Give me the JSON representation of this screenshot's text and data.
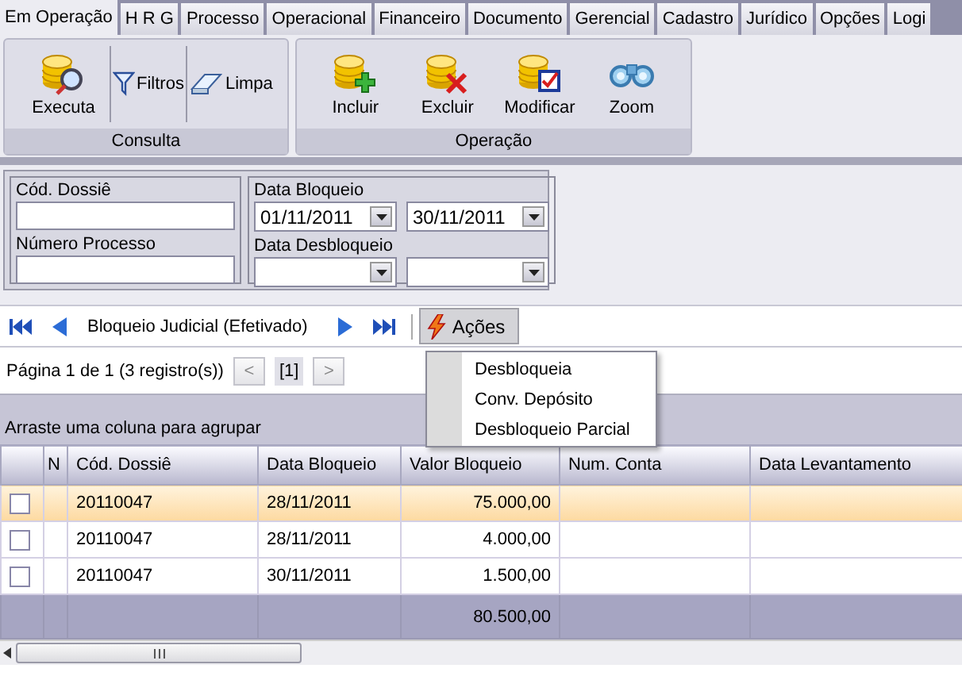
{
  "tabs": [
    {
      "label": "Em Operação",
      "selected": true
    },
    {
      "label": "H R G",
      "selected": false
    },
    {
      "label": "Processo",
      "selected": false
    },
    {
      "label": "Operacional",
      "selected": false
    },
    {
      "label": "Financeiro",
      "selected": false
    },
    {
      "label": "Documento",
      "selected": false
    },
    {
      "label": "Gerencial",
      "selected": false
    },
    {
      "label": "Cadastro",
      "selected": false
    },
    {
      "label": "Jurídico",
      "selected": false
    },
    {
      "label": "Opções",
      "selected": false
    },
    {
      "label": "Logi",
      "selected": false
    }
  ],
  "ribbon": {
    "groups": [
      {
        "title": "Consulta",
        "buttons": [
          {
            "label": "Executa",
            "kind": "large"
          },
          {
            "label": "Filtros",
            "kind": "small"
          },
          {
            "label": "Limpa",
            "kind": "small"
          }
        ]
      },
      {
        "title": "Operação",
        "buttons": [
          {
            "label": "Incluir",
            "kind": "large"
          },
          {
            "label": "Excluir",
            "kind": "large"
          },
          {
            "label": "Modificar",
            "kind": "large"
          },
          {
            "label": "Zoom",
            "kind": "large"
          }
        ]
      }
    ]
  },
  "filters": {
    "dossie": {
      "label": "Cód. Dossiê"
    },
    "processo": {
      "label": "Número Processo"
    },
    "data_bloqueio": {
      "label": "Data Bloqueio",
      "from": "01/11/2011",
      "to": "30/11/2011"
    },
    "data_desbloqueio": {
      "label": "Data Desbloqueio"
    }
  },
  "navigator": {
    "title": "Bloqueio Judicial (Efetivado)",
    "actions_label": "Ações"
  },
  "pager": {
    "summary": "Página 1 de 1 (3 registro(s))",
    "prev": "<",
    "current": "[1]",
    "next": ">"
  },
  "group_hint": "Arraste uma coluna para agrupar",
  "actions_menu": {
    "items": [
      "Desbloqueia",
      "Conv. Depósito",
      "Desbloqueio Parcial"
    ]
  },
  "grid": {
    "columns": [
      "N",
      "Cód. Dossiê",
      "Data Bloqueio",
      "Valor Bloqueio",
      "Num. Conta",
      "Data Levantamento"
    ],
    "rows": [
      {
        "checked": false,
        "selected": true,
        "dossie": "20110047",
        "data": "28/11/2011",
        "valor": "75.000,00"
      },
      {
        "checked": false,
        "selected": false,
        "dossie": "20110047",
        "data": "28/11/2011",
        "valor": "4.000,00"
      },
      {
        "checked": false,
        "selected": false,
        "dossie": "20110047",
        "data": "30/11/2011",
        "valor": "1.500,00"
      }
    ],
    "total": "80.500,00"
  }
}
